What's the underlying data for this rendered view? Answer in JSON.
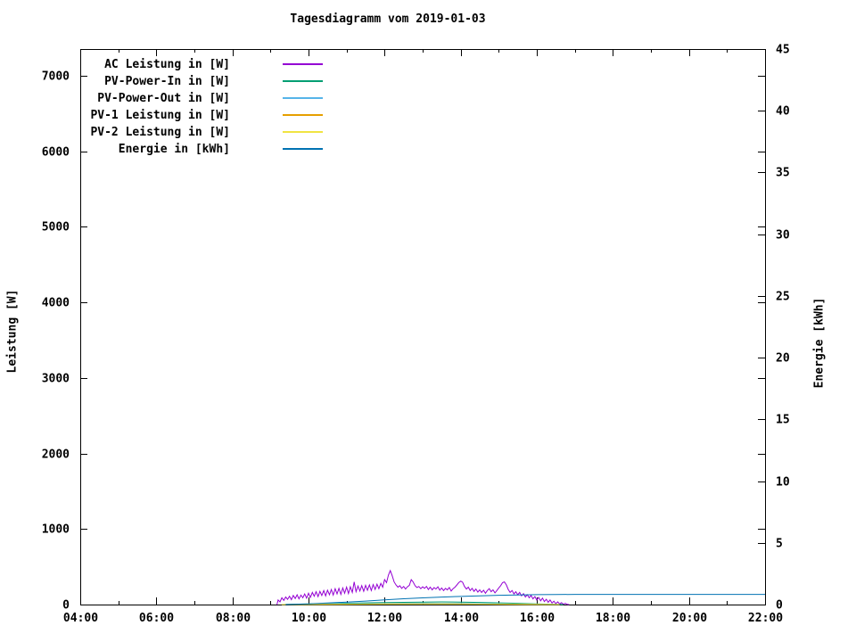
{
  "title": "Tagesdiagramm vom 2019-01-03",
  "y1_axis": {
    "label": "Leistung [W]",
    "ticks": [
      0,
      1000,
      2000,
      3000,
      4000,
      5000,
      6000,
      7000
    ]
  },
  "y2_axis": {
    "label": "Energie [kWh]",
    "ticks": [
      0,
      5,
      10,
      15,
      20,
      25,
      30,
      35,
      40,
      45
    ]
  },
  "x_axis": {
    "tick_labels": [
      "04:00",
      "06:00",
      "08:00",
      "10:00",
      "12:00",
      "14:00",
      "16:00",
      "18:00",
      "20:00",
      "22:00"
    ],
    "tick_hours": [
      4,
      6,
      8,
      10,
      12,
      14,
      16,
      18,
      20,
      22
    ],
    "minor_tick_hours": [
      5,
      7,
      9,
      11,
      13,
      15,
      17,
      19,
      21
    ]
  },
  "legend": [
    {
      "label": "AC Leistung in [W]",
      "color": "#9400d3"
    },
    {
      "label": "PV-Power-In in [W]",
      "color": "#009e73"
    },
    {
      "label": "PV-Power-Out in [W]",
      "color": "#56b4e9"
    },
    {
      "label": "PV-1 Leistung in [W]",
      "color": "#e69f00"
    },
    {
      "label": "PV-2 Leistung in [W]",
      "color": "#f0e442"
    },
    {
      "label": "Energie in [kWh]",
      "color": "#0072b2"
    }
  ],
  "chart_data": {
    "type": "line",
    "title": "Tagesdiagramm vom 2019-01-03",
    "xlabel": "",
    "x_unit": "time of day (hours)",
    "x_range": [
      4,
      22
    ],
    "y1label": "Leistung [W]",
    "y1lim": [
      0,
      7355
    ],
    "y1_ticks": [
      0,
      1000,
      2000,
      3000,
      4000,
      5000,
      6000,
      7000
    ],
    "y2label": "Energie [kWh]",
    "y2lim": [
      0,
      45
    ],
    "y2_ticks": [
      0,
      5,
      10,
      15,
      20,
      25,
      30,
      35,
      40,
      45
    ],
    "grid": false,
    "legend_position": "top-left inside",
    "series": [
      {
        "name": "AC Leistung in [W]",
        "color": "#9400d3",
        "axis": "y1",
        "points": [
          [
            9.17,
            0
          ],
          [
            9.2,
            60
          ],
          [
            9.25,
            35
          ],
          [
            9.3,
            90
          ],
          [
            9.35,
            55
          ],
          [
            9.4,
            100
          ],
          [
            9.45,
            70
          ],
          [
            9.5,
            110
          ],
          [
            9.55,
            65
          ],
          [
            9.6,
            120
          ],
          [
            9.65,
            80
          ],
          [
            9.7,
            130
          ],
          [
            9.75,
            75
          ],
          [
            9.8,
            125
          ],
          [
            9.85,
            90
          ],
          [
            9.9,
            140
          ],
          [
            9.95,
            85
          ],
          [
            10.0,
            150
          ],
          [
            10.05,
            95
          ],
          [
            10.1,
            160
          ],
          [
            10.15,
            110
          ],
          [
            10.2,
            170
          ],
          [
            10.25,
            105
          ],
          [
            10.3,
            175
          ],
          [
            10.35,
            120
          ],
          [
            10.4,
            185
          ],
          [
            10.45,
            115
          ],
          [
            10.5,
            190
          ],
          [
            10.55,
            130
          ],
          [
            10.6,
            200
          ],
          [
            10.65,
            125
          ],
          [
            10.7,
            210
          ],
          [
            10.75,
            140
          ],
          [
            10.8,
            215
          ],
          [
            10.85,
            135
          ],
          [
            10.9,
            220
          ],
          [
            10.95,
            150
          ],
          [
            11.0,
            230
          ],
          [
            11.05,
            145
          ],
          [
            11.1,
            235
          ],
          [
            11.15,
            160
          ],
          [
            11.2,
            300
          ],
          [
            11.25,
            170
          ],
          [
            11.3,
            245
          ],
          [
            11.35,
            180
          ],
          [
            11.4,
            250
          ],
          [
            11.45,
            175
          ],
          [
            11.5,
            255
          ],
          [
            11.55,
            190
          ],
          [
            11.6,
            260
          ],
          [
            11.65,
            185
          ],
          [
            11.7,
            265
          ],
          [
            11.75,
            200
          ],
          [
            11.8,
            270
          ],
          [
            11.85,
            210
          ],
          [
            11.9,
            280
          ],
          [
            11.95,
            230
          ],
          [
            12.0,
            330
          ],
          [
            12.05,
            290
          ],
          [
            12.1,
            390
          ],
          [
            12.15,
            450
          ],
          [
            12.2,
            380
          ],
          [
            12.25,
            300
          ],
          [
            12.3,
            260
          ],
          [
            12.35,
            230
          ],
          [
            12.4,
            250
          ],
          [
            12.45,
            215
          ],
          [
            12.5,
            240
          ],
          [
            12.55,
            205
          ],
          [
            12.6,
            235
          ],
          [
            12.65,
            255
          ],
          [
            12.7,
            330
          ],
          [
            12.75,
            300
          ],
          [
            12.8,
            250
          ],
          [
            12.85,
            225
          ],
          [
            12.9,
            240
          ],
          [
            12.95,
            210
          ],
          [
            13.0,
            235
          ],
          [
            13.05,
            215
          ],
          [
            13.1,
            240
          ],
          [
            13.15,
            200
          ],
          [
            13.2,
            230
          ],
          [
            13.25,
            195
          ],
          [
            13.3,
            225
          ],
          [
            13.35,
            205
          ],
          [
            13.4,
            235
          ],
          [
            13.45,
            190
          ],
          [
            13.5,
            220
          ],
          [
            13.55,
            185
          ],
          [
            13.6,
            215
          ],
          [
            13.65,
            195
          ],
          [
            13.7,
            225
          ],
          [
            13.75,
            180
          ],
          [
            13.8,
            210
          ],
          [
            13.85,
            230
          ],
          [
            13.9,
            260
          ],
          [
            13.95,
            290
          ],
          [
            14.0,
            310
          ],
          [
            14.05,
            295
          ],
          [
            14.1,
            240
          ],
          [
            14.15,
            205
          ],
          [
            14.2,
            230
          ],
          [
            14.25,
            185
          ],
          [
            14.3,
            215
          ],
          [
            14.35,
            175
          ],
          [
            14.4,
            205
          ],
          [
            14.45,
            165
          ],
          [
            14.5,
            195
          ],
          [
            14.55,
            160
          ],
          [
            14.6,
            190
          ],
          [
            14.65,
            150
          ],
          [
            14.7,
            185
          ],
          [
            14.75,
            210
          ],
          [
            14.8,
            170
          ],
          [
            14.85,
            195
          ],
          [
            14.9,
            155
          ],
          [
            14.95,
            185
          ],
          [
            15.0,
            220
          ],
          [
            15.05,
            250
          ],
          [
            15.1,
            290
          ],
          [
            15.15,
            300
          ],
          [
            15.2,
            260
          ],
          [
            15.25,
            200
          ],
          [
            15.3,
            160
          ],
          [
            15.35,
            185
          ],
          [
            15.4,
            140
          ],
          [
            15.45,
            170
          ],
          [
            15.5,
            130
          ],
          [
            15.55,
            160
          ],
          [
            15.6,
            115
          ],
          [
            15.65,
            145
          ],
          [
            15.7,
            100
          ],
          [
            15.75,
            130
          ],
          [
            15.8,
            90
          ],
          [
            15.85,
            120
          ],
          [
            15.9,
            75
          ],
          [
            15.95,
            105
          ],
          [
            16.0,
            60
          ],
          [
            16.05,
            95
          ],
          [
            16.1,
            50
          ],
          [
            16.15,
            85
          ],
          [
            16.2,
            40
          ],
          [
            16.25,
            70
          ],
          [
            16.3,
            30
          ],
          [
            16.35,
            60
          ],
          [
            16.4,
            20
          ],
          [
            16.45,
            45
          ],
          [
            16.5,
            12
          ],
          [
            16.55,
            35
          ],
          [
            16.6,
            8
          ],
          [
            16.65,
            25
          ],
          [
            16.7,
            5
          ],
          [
            16.75,
            15
          ],
          [
            16.8,
            2
          ],
          [
            16.85,
            0
          ]
        ]
      },
      {
        "name": "PV-Power-In in [W]",
        "color": "#009e73",
        "axis": "y1",
        "points": [
          [
            9.3,
            0
          ],
          [
            10.0,
            8
          ],
          [
            10.5,
            14
          ],
          [
            11.0,
            18
          ],
          [
            11.5,
            22
          ],
          [
            12.0,
            26
          ],
          [
            12.5,
            30
          ],
          [
            13.0,
            33
          ],
          [
            13.5,
            35
          ],
          [
            14.0,
            33
          ],
          [
            14.5,
            28
          ],
          [
            15.0,
            22
          ],
          [
            15.5,
            16
          ],
          [
            16.0,
            9
          ],
          [
            16.5,
            3
          ],
          [
            16.7,
            0
          ]
        ]
      },
      {
        "name": "PV-Power-Out in [W]",
        "color": "#56b4e9",
        "axis": "y1",
        "points": [
          [
            9.3,
            0
          ],
          [
            10.5,
            8
          ],
          [
            12.0,
            14
          ],
          [
            13.0,
            18
          ],
          [
            14.0,
            16
          ],
          [
            15.0,
            10
          ],
          [
            16.0,
            4
          ],
          [
            16.6,
            0
          ]
        ]
      },
      {
        "name": "PV-1 Leistung in [W]",
        "color": "#e69f00",
        "axis": "y1",
        "points": [
          [
            9.3,
            0
          ],
          [
            12.0,
            8
          ],
          [
            13.5,
            10
          ],
          [
            16.6,
            0
          ]
        ]
      },
      {
        "name": "PV-2 Leistung in [W]",
        "color": "#f0e442",
        "axis": "y1",
        "points": [
          [
            9.3,
            0
          ],
          [
            12.0,
            6
          ],
          [
            13.5,
            8
          ],
          [
            16.6,
            0
          ]
        ]
      },
      {
        "name": "Energie in [kWh]",
        "color": "#0072b2",
        "axis": "y2",
        "points": [
          [
            9.4,
            0.0
          ],
          [
            10.0,
            0.05
          ],
          [
            10.5,
            0.12
          ],
          [
            11.0,
            0.2
          ],
          [
            11.5,
            0.28
          ],
          [
            12.0,
            0.38
          ],
          [
            12.5,
            0.47
          ],
          [
            13.0,
            0.54
          ],
          [
            13.5,
            0.61
          ],
          [
            14.0,
            0.66
          ],
          [
            14.5,
            0.71
          ],
          [
            15.0,
            0.75
          ],
          [
            15.5,
            0.78
          ],
          [
            16.0,
            0.8
          ],
          [
            16.5,
            0.81
          ],
          [
            17.0,
            0.82
          ],
          [
            22.0,
            0.82
          ]
        ]
      }
    ]
  }
}
